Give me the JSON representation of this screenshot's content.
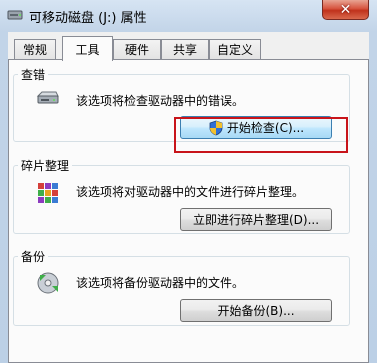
{
  "window": {
    "title": "可移动磁盘 (J:) 属性",
    "close_glyph": "✕"
  },
  "tabs": [
    {
      "label": "常规"
    },
    {
      "label": "工具"
    },
    {
      "label": "硬件"
    },
    {
      "label": "共享"
    },
    {
      "label": "自定义"
    }
  ],
  "active_tab": "工具",
  "sections": {
    "error_check": {
      "title": "查错",
      "description": "该选项将检查驱动器中的错误。",
      "button_label": "开始检查(C)...",
      "icon": "drive-icon"
    },
    "defrag": {
      "title": "碎片整理",
      "description": "该选项将对驱动器中的文件进行碎片整理。",
      "button_label": "立即进行碎片整理(D)...",
      "icon": "defrag-icon"
    },
    "backup": {
      "title": "备份",
      "description": "该选项将备份驱动器中的文件。",
      "button_label": "开始备份(B)...",
      "icon": "backup-icon"
    }
  },
  "colors": {
    "highlight": "#c8141a",
    "close_button": "#c0321c",
    "focus_border": "#3c7fb1"
  }
}
